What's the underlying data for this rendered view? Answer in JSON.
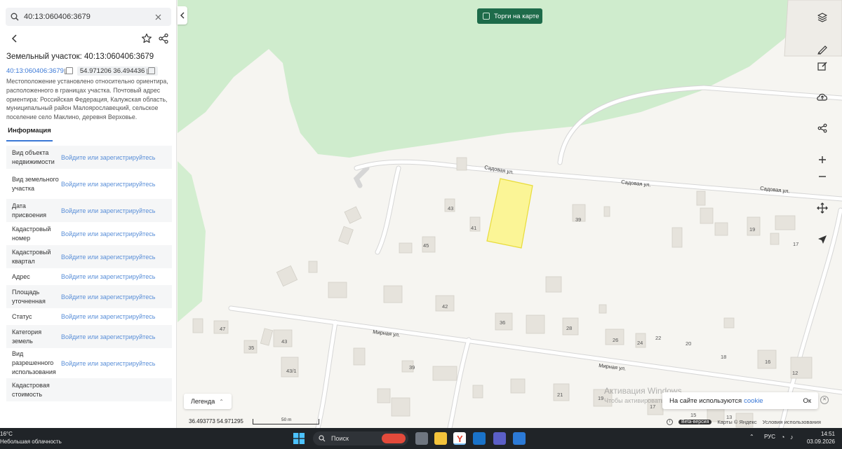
{
  "search": {
    "value": "40:13:060406:3679"
  },
  "panel": {
    "title": "Земельный участок: 40:13:060406:3679",
    "cadastral_link": "40:13:060406:3679",
    "coordinates": "54.971206 36.494436",
    "description": "Местоположение установлено относительно ориентира, расположенного в границах участка. Почтовый адрес ориентира: Российская Федерация, Калужская область, муниципальный район Малоярославецкий, сельское поселение село Маклино, деревня Верховье.",
    "tab_info": "Информация",
    "rows": [
      {
        "label": "Вид объекта недвижимости",
        "value": "Войдите или зарегистрируйтесь"
      },
      {
        "label": "Вид земельного участка",
        "value": "Войдите или зарегистрируйтесь"
      },
      {
        "label": "Дата присвоения",
        "value": "Войдите или зарегистрируйтесь"
      },
      {
        "label": "Кадастровый номер",
        "value": "Войдите или зарегистрируйтесь"
      },
      {
        "label": "Кадастровый квартал",
        "value": "Войдите или зарегистрируйтесь"
      },
      {
        "label": "Адрес",
        "value": "Войдите или зарегистрируйтесь"
      },
      {
        "label": "Площадь уточненная",
        "value": "Войдите или зарегистрируйтесь"
      },
      {
        "label": "Статус",
        "value": "Войдите или зарегистрируйтесь"
      },
      {
        "label": "Категория земель",
        "value": "Войдите или зарегистрируйтесь"
      },
      {
        "label": "Вид разрешенного использования",
        "value": "Войдите или зарегистрируйтесь"
      },
      {
        "label": "Кадастровая стоимость",
        "value": ""
      }
    ]
  },
  "map": {
    "torgi_label": "Торги на карте",
    "legend_label": "Легенда",
    "coord_readout": "36.493773  54.971295",
    "scale_label": "50 m",
    "beta_label": "Beta-версия",
    "maps_label": "Карты © Яндекс",
    "terms_label": "Условия использования",
    "streets": {
      "sadovaya": "Садовая ул.",
      "mirnaya": "Мирная ул."
    },
    "house_numbers": [
      "43",
      "41",
      "45",
      "39",
      "19",
      "17",
      "42",
      "36",
      "28",
      "26",
      "24",
      "22",
      "20",
      "18",
      "16",
      "12",
      "47",
      "43",
      "35",
      "43/1",
      "39",
      "21",
      "19",
      "17",
      "15",
      "13"
    ],
    "colors": {
      "forest": "#cfeccd",
      "parcel_fill": "#fbf596",
      "parcel_stroke": "#e8dc3a",
      "building": "#e6e3dc"
    }
  },
  "activation": {
    "line1": "Активация Windows",
    "line2": "Чтобы активировать Windows, перейдите в раздел \"Параметры\"."
  },
  "cookie": {
    "text_prefix": "На сайте используются ",
    "link": "cookie",
    "ok": "Ок"
  },
  "taskbar": {
    "temp": "16°C",
    "weather": "Небольшая облачность",
    "search": "Поиск",
    "lang": "РУС",
    "time": "14:51",
    "date": "03.09.2026"
  },
  "icons": [
    "search-icon",
    "close-icon",
    "back-icon",
    "star-icon",
    "share-icon",
    "layers-icon",
    "ruler-icon",
    "edit-icon",
    "upload-icon",
    "share-icon",
    "zoom-in-icon",
    "zoom-out-icon",
    "move-icon",
    "locate-icon"
  ]
}
